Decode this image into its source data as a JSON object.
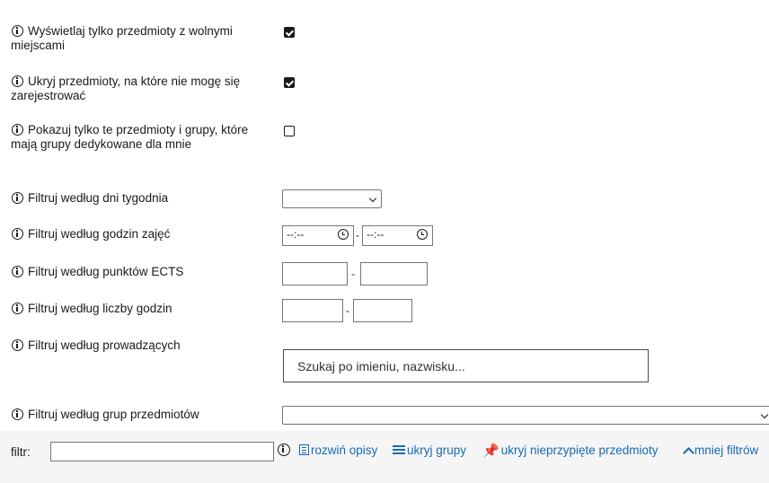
{
  "filters": [
    {
      "id": "free-seats",
      "label": "Wyświetlaj tylko przedmioty z wolnymi miejscami",
      "checked": true
    },
    {
      "id": "hide-unregisterable",
      "label": "Ukryj przedmioty, na które nie mogę się zarejestrować",
      "checked": true
    },
    {
      "id": "dedicated-groups",
      "label": "Pokazuj tylko te przedmioty i grupy, które mają grupy dedykowane dla mnie",
      "checked": false
    },
    {
      "id": "weekdays",
      "label": "Filtruj według dni tygodnia",
      "selected": ""
    },
    {
      "id": "hours",
      "label": "Filtruj według godzin zajęć",
      "from": "--:--",
      "to": "--:--",
      "separator": "-"
    },
    {
      "id": "ects",
      "label": "Filtruj według punktów ECTS",
      "from": "",
      "to": "",
      "separator": "-"
    },
    {
      "id": "hours-count",
      "label": "Filtruj według liczby godzin",
      "from": "",
      "to": "",
      "separator": "-"
    },
    {
      "id": "lecturers",
      "label": "Filtruj według prowadzących",
      "placeholder": "Szukaj po imieniu, nazwisku..."
    },
    {
      "id": "subject-groups",
      "label": "Filtruj według grup przedmiotów",
      "selected": ""
    }
  ],
  "bottom_bar": {
    "filter_label": "filtr:",
    "filter_value": "",
    "links": {
      "expand_descriptions": "rozwiń opisy",
      "hide_groups": "ukryj grupy",
      "hide_unpinned": "ukryj nieprzypięte przedmioty",
      "less_filters": "mniej filtrów"
    }
  },
  "colors": {
    "link": "#1769b5",
    "bar_background": "#f5f5f5"
  }
}
